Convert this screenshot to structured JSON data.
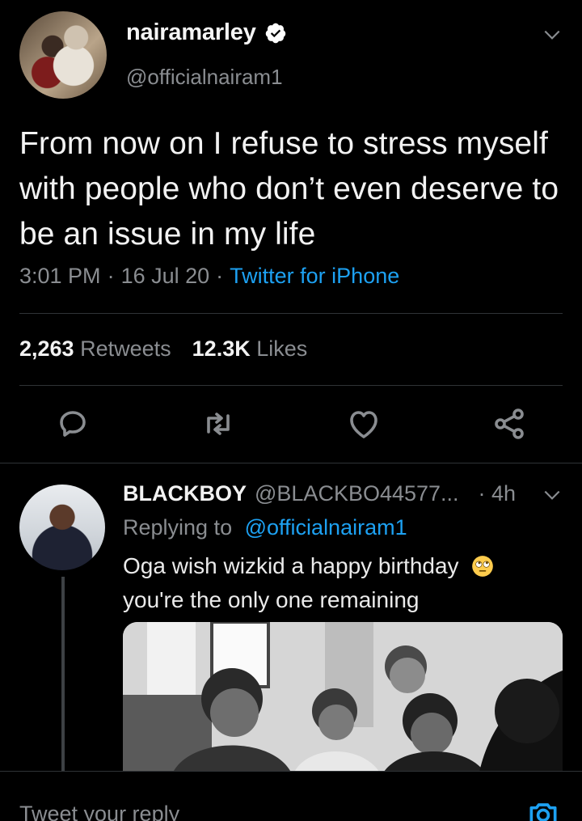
{
  "tweet": {
    "display_name": "nairamarley",
    "handle": "@officialnairam1",
    "verified": true,
    "text": "From now on I refuse to stress myself with people who don’t even deserve to be an issue in my life",
    "time": "3:01 PM",
    "date": "16 Jul 20",
    "separator": "·",
    "source": "Twitter for iPhone",
    "retweets_count": "2,263",
    "retweets_label": "Retweets",
    "likes_count": "12.3K",
    "likes_label": "Likes",
    "icons": {
      "reply": "reply-icon",
      "retweet": "retweet-icon",
      "like": "heart-icon",
      "share": "share-icon",
      "more": "chevron-down-icon",
      "verified": "verified-badge-icon"
    }
  },
  "reply": {
    "display_name": "BLACKBOY",
    "handle": "@BLACKBO44577...",
    "time": "· 4h",
    "replying_prefix": "Replying to",
    "replying_to": "@officialnairam1",
    "text": "Oga wish wizkid a happy birthday",
    "text_line2": "you're the only one remaining",
    "emoji": "face-with-rolling-eyes"
  },
  "composer": {
    "placeholder": "Tweet your reply",
    "camera_icon": "camera-icon"
  },
  "colors": {
    "background": "#000000",
    "accent": "#1da1f2",
    "muted": "#8a8d91",
    "divider": "#2f3336"
  }
}
